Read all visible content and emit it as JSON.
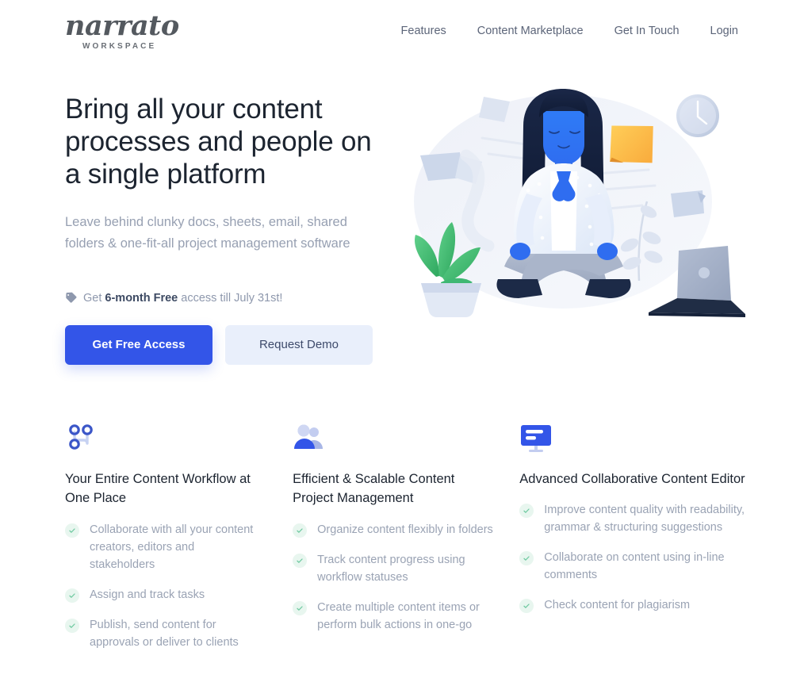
{
  "brand": {
    "name": "narrato",
    "tagline": "WORKSPACE",
    "logo_icon": "narrato-wordmark"
  },
  "nav": {
    "items": [
      {
        "label": "Features",
        "name": "nav-link-features"
      },
      {
        "label": "Content Marketplace",
        "name": "nav-link-content-marketplace"
      },
      {
        "label": "Get In Touch",
        "name": "nav-link-get-in-touch"
      },
      {
        "label": "Login",
        "name": "nav-link-login"
      }
    ]
  },
  "hero": {
    "title": "Bring all your content processes and people on a single platform",
    "subtitle": "Leave behind clunky docs, sheets, email, shared folders & one-fit-all project management software",
    "promo": {
      "icon": "tag-icon",
      "prefix": "Get ",
      "highlight": "6-month Free",
      "suffix": " access till July 31st!"
    },
    "primary_cta": "Get Free Access",
    "secondary_cta": "Request Demo",
    "illustration": "meditating-woman-with-laptop-plant-clock-illustration"
  },
  "features": [
    {
      "icon": "workflow-nodes-icon",
      "title": "Your Entire Content Workflow at One Place",
      "items": [
        "Collaborate with all your content creators, editors and stakeholders",
        "Assign and track tasks",
        "Publish, send content for approvals or deliver to clients"
      ]
    },
    {
      "icon": "people-group-icon",
      "title": "Efficient & Scalable Content Project Management",
      "items": [
        "Organize content flexibly in folders",
        "Track content progress using workflow statuses",
        "Create multiple content items or perform bulk actions in one-go"
      ]
    },
    {
      "icon": "monitor-editor-icon",
      "title": "Advanced Collaborative Content Editor",
      "items": [
        "Improve content quality with readability, grammar & structuring suggestions",
        "Collaborate on content using in-line comments",
        "Check content for plagiarism"
      ]
    }
  ],
  "colors": {
    "primary_blue": "#3355e8",
    "secondary_button_bg": "#e9effb",
    "heading": "#1c2430",
    "muted_text": "#97a0b2",
    "nav_text": "#5c6579",
    "check_green": "#6ec9a0",
    "check_badge_bg": "#e8f6ef"
  }
}
